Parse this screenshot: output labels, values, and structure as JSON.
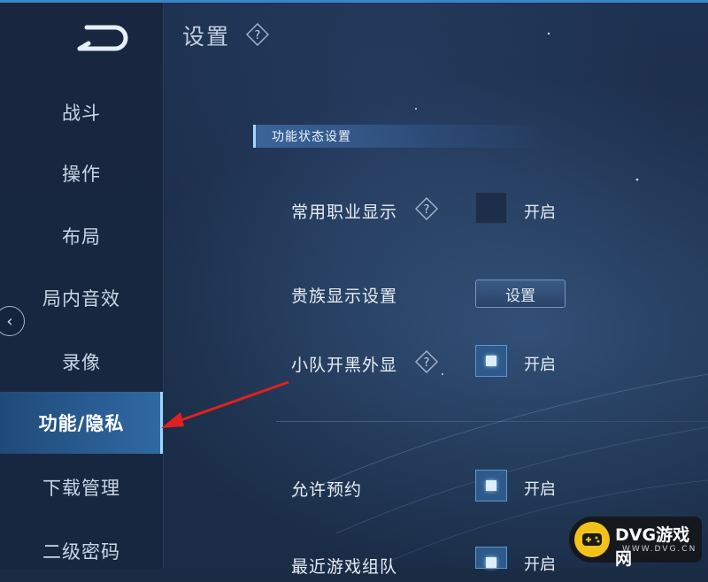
{
  "header": {
    "title": "设置"
  },
  "sidebar": {
    "items": [
      {
        "label": "战斗"
      },
      {
        "label": "操作"
      },
      {
        "label": "布局"
      },
      {
        "label": "局内音效"
      },
      {
        "label": "录像"
      },
      {
        "label": "功能/隐私"
      },
      {
        "label": "下载管理"
      },
      {
        "label": "二级密码"
      }
    ],
    "active_index": 5
  },
  "section": {
    "title": "功能状态设置"
  },
  "settings": [
    {
      "label": "常用职业显示",
      "has_help": true,
      "control": "checkbox",
      "checked": false,
      "state_text": "开启"
    },
    {
      "label": "贵族显示设置",
      "has_help": false,
      "control": "button",
      "button_label": "设置"
    },
    {
      "label": "小队开黑外显",
      "has_help": true,
      "control": "checkbox",
      "checked": true,
      "state_text": "开启"
    },
    {
      "label": "允许预约",
      "has_help": false,
      "control": "checkbox",
      "checked": true,
      "state_text": "开启"
    },
    {
      "label": "最近游戏组队",
      "control": "checkbox",
      "checked": true,
      "state_text": "开启"
    }
  ],
  "watermark": {
    "title": "DVG游戏网",
    "subtitle": "WWW.DVG.CN"
  },
  "colors": {
    "accent": "#2f6aa3",
    "active_highlight": "#9ed6ff",
    "arrow": "#e02020",
    "badge": "#f2c21b"
  },
  "icons": [
    "back-icon",
    "help-icon",
    "collapse-left-icon",
    "red-arrow-icon"
  ]
}
